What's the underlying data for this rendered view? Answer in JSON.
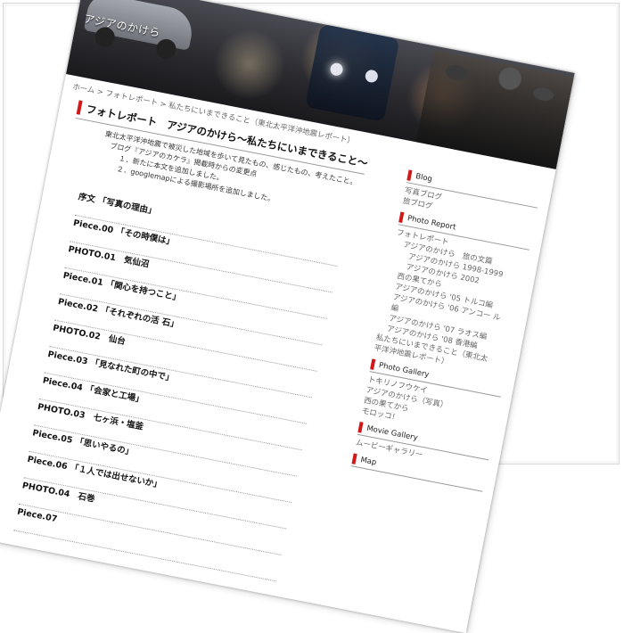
{
  "site": {
    "title": "アジアのかけら"
  },
  "breadcrumb": {
    "home": "ホーム",
    "sep1": ">",
    "section": "フォトレポート",
    "sep2": ">",
    "current": "私たちにいまできること（東北太平洋沖地震レポート）"
  },
  "article": {
    "heading": "フォトレポート　アジアのかけら～私たちにいまできること～",
    "intro": [
      "東北太平洋沖地震で被災した地域を歩いて見たもの、感じたもの、考えたこと。",
      "ブログ『アジアのカケラ』掲載時からの変更点",
      "１．新たに本文を追加しました。",
      "２．googlemapによる撮影場所を追加しました。"
    ],
    "toc": [
      "序文 「写真の理由」",
      "Piece.00 「その時僕は」",
      "PHOTO.01　気仙沼",
      "Piece.01 「関心を持つこと」",
      "Piece.02 「それぞれの活 石」",
      "PHOTO.02　仙台",
      "Piece.03 「見なれた町の中で」",
      "Piece.04 「会家と工場」",
      "PHOTO.03　七ヶ浜・塩釜",
      "Piece.05 「思いやるの」",
      "Piece.06 「１人では出せないか」",
      "PHOTO.04　石巻",
      "Piece.07"
    ]
  },
  "sidebar": {
    "sections": [
      {
        "title": "Blog",
        "links": [
          {
            "label": "写真ブログ",
            "level": 0
          },
          {
            "label": "旅ブログ",
            "level": 0
          }
        ]
      },
      {
        "title": "Photo Report",
        "links": [
          {
            "label": "フォトレポート",
            "level": 0
          },
          {
            "label": "アジアのかけら　旅の文篇",
            "level": 1
          },
          {
            "label": "アジアのかけら 1998-1999",
            "level": 2
          },
          {
            "label": "アジアのかけら 2002",
            "level": 2
          },
          {
            "label": "西の果てから",
            "level": 1
          },
          {
            "label": "アジアのかけら '05 トルコ編",
            "level": 1
          },
          {
            "label": "アジアのかけら '06 アンコー ル編",
            "level": 1
          },
          {
            "label": "アジアのかけら '07 ラオス編",
            "level": 1
          },
          {
            "label": "アジアのかけら '08 香港編",
            "level": 1
          },
          {
            "label": "私たちにいまできること（東北太平洋沖地震レポート）",
            "level": 0
          }
        ]
      },
      {
        "title": "Photo Gallery",
        "links": [
          {
            "label": "トキリノフウケイ",
            "level": 0
          },
          {
            "label": "アジアのかけら（写真）",
            "level": 0
          },
          {
            "label": "西の果てから",
            "level": 0
          },
          {
            "label": "モロッコ！",
            "level": 0
          }
        ]
      },
      {
        "title": "Movie Gallery",
        "links": [
          {
            "label": "ムービーギャラリー",
            "level": 0
          }
        ]
      },
      {
        "title": "Map",
        "links": []
      }
    ]
  }
}
